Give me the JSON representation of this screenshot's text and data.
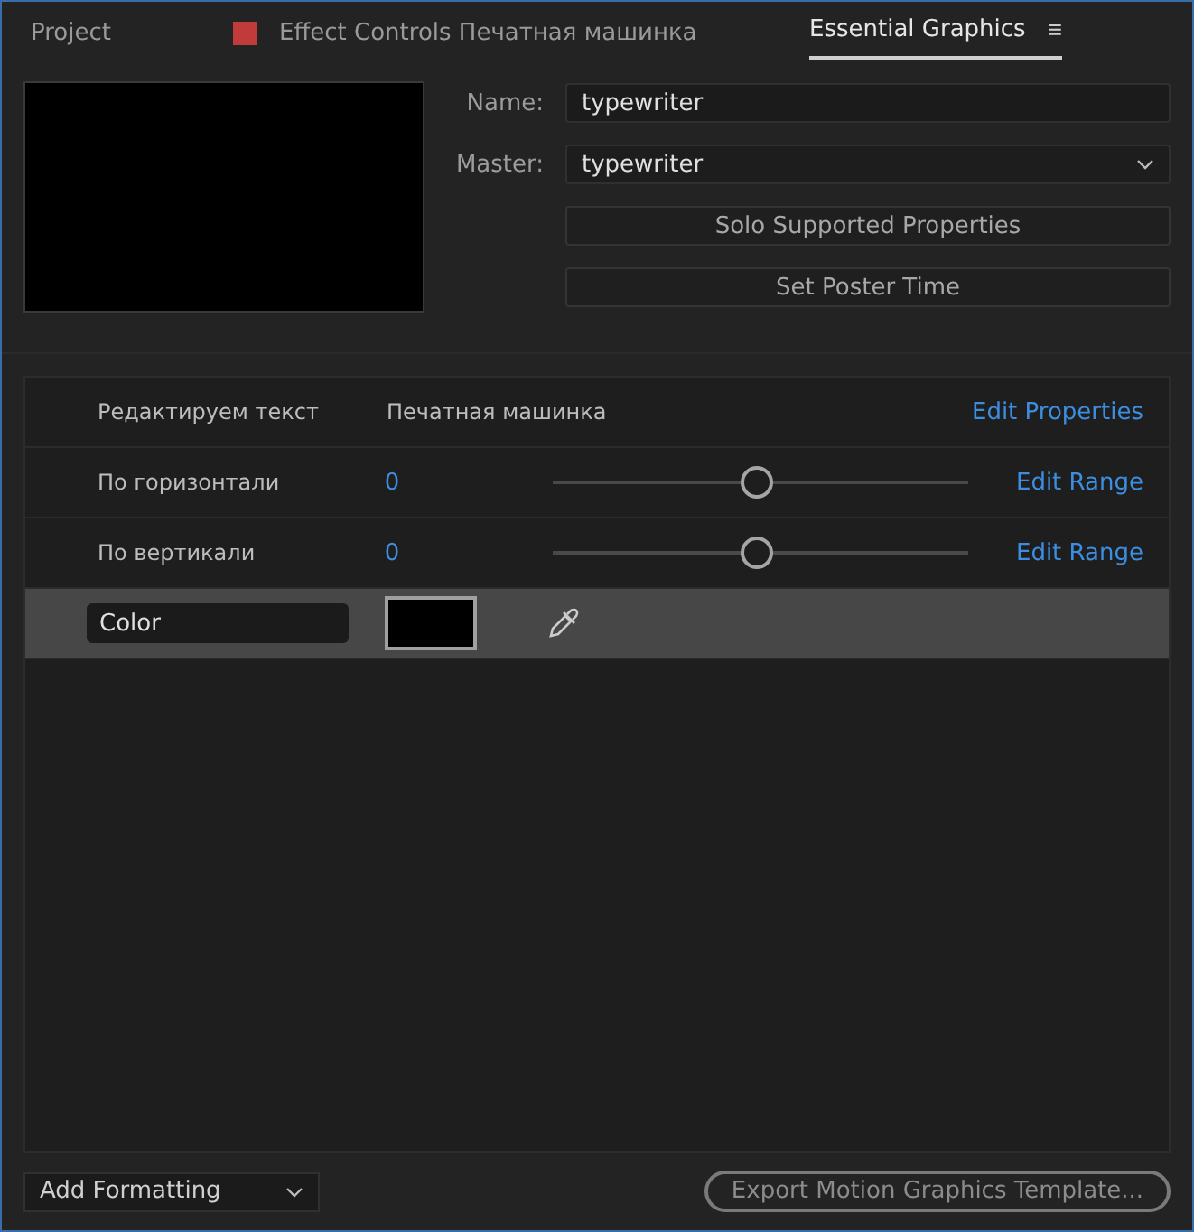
{
  "tabs": [
    {
      "label": "Project",
      "selected": false,
      "kind": "plain"
    },
    {
      "label": "Effect Controls Печатная машинка",
      "selected": false,
      "kind": "marked",
      "color": "#c23b3b"
    },
    {
      "label": "Essential Graphics",
      "selected": true,
      "kind": "menu",
      "menu_icon": "≡"
    }
  ],
  "name_field": {
    "label": "Name:",
    "value": "typewriter"
  },
  "master_field": {
    "label": "Master:",
    "value": "typewriter"
  },
  "buttons": [
    "Solo Supported Properties",
    "Set Poster Time"
  ],
  "properties": [
    {
      "kind": "text",
      "label": "Редактируем текст",
      "value": "Печатная машинка",
      "action": "Edit Properties",
      "selected": false
    },
    {
      "kind": "slider",
      "label": "По горизонтали",
      "value": "0",
      "level": 0.49,
      "action": "Edit Range",
      "selected": false
    },
    {
      "kind": "slider",
      "label": "По вертикали",
      "value": "0",
      "level": 0.49,
      "action": "Edit Range",
      "selected": false
    },
    {
      "kind": "color",
      "label": "Color",
      "color": "#000000",
      "selected": true
    }
  ],
  "add_formatting": "Add Formatting",
  "export_button": "Export Motion Graphics Template..."
}
